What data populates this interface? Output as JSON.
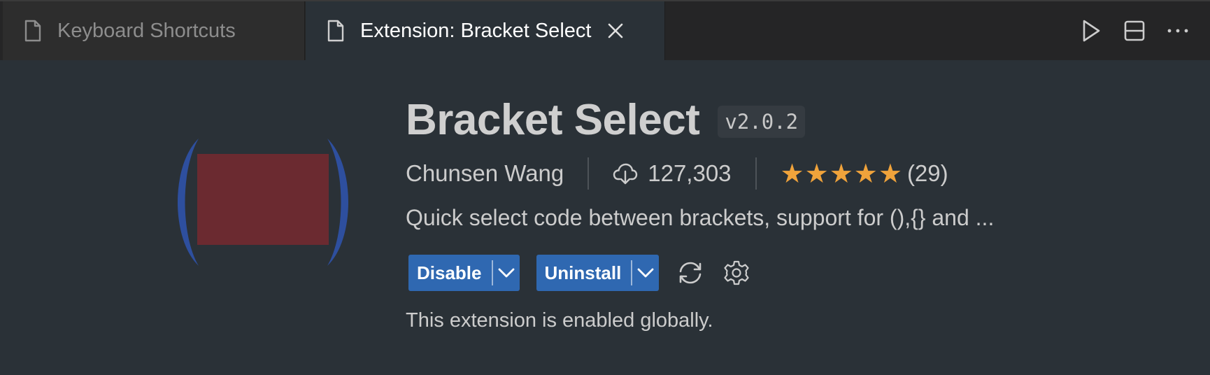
{
  "tabs": [
    {
      "label": "Keyboard Shortcuts",
      "active": false
    },
    {
      "label": "Extension: Bracket Select",
      "active": true
    }
  ],
  "toolbar": {
    "icons": [
      "run-icon",
      "split-editor-icon",
      "more-actions-icon"
    ]
  },
  "extension": {
    "name": "Bracket Select",
    "version": "v2.0.2",
    "publisher": "Chunsen Wang",
    "installs": "127,303",
    "rating_stars": 5,
    "rating_count": "(29)",
    "description": "Quick select code between brackets, support for (),{} and ...",
    "status_text": "This extension is enabled globally."
  },
  "buttons": {
    "disable_label": "Disable",
    "uninstall_label": "Uninstall"
  },
  "colors": {
    "accent": "#2f68b1",
    "star": "#f0a33b",
    "logo_bracket": "#2e4f9e",
    "logo_box": "#6b2a30"
  }
}
